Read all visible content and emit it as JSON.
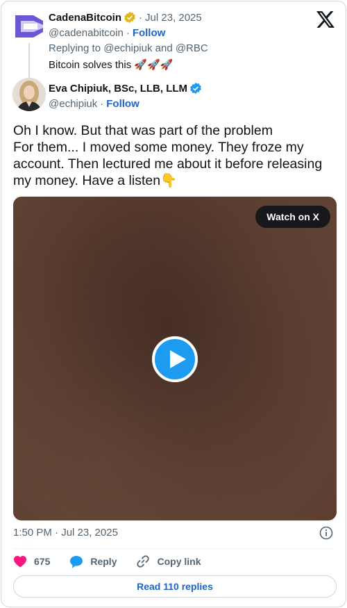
{
  "parent": {
    "name": "CadenaBitcoin",
    "separator": "·",
    "date": "Jul 23, 2025",
    "handle": "@cadenabitcoin",
    "follow": "Follow",
    "replying": "Replying to @echipiuk and @RBC",
    "text": "Bitcoin solves this",
    "emoji": "🚀🚀🚀",
    "badge_color": "#e2b719"
  },
  "author": {
    "name": "Eva Chipiuk, BSc, LLB, LLM",
    "handle": "@echipiuk",
    "follow": "Follow",
    "badge_color": "#1d9bf0"
  },
  "tweet": {
    "lines": [
      "Oh I know. But that was part of the problem",
      "For them... I moved some money. They froze my",
      "account. Then lectured me about it before releasing",
      "my money. Have a listen👇"
    ]
  },
  "video": {
    "watch_label": "Watch on X",
    "play_icon": "play-icon"
  },
  "meta": {
    "timestamp": "1:50 PM · Jul 23, 2025"
  },
  "actions": {
    "likes": "675",
    "reply": "Reply",
    "copy_link": "Copy link"
  },
  "replies_button": "Read 110 replies",
  "colors": {
    "accent": "#1d9bf0",
    "link": "#1d64c8",
    "like": "#f91880"
  }
}
